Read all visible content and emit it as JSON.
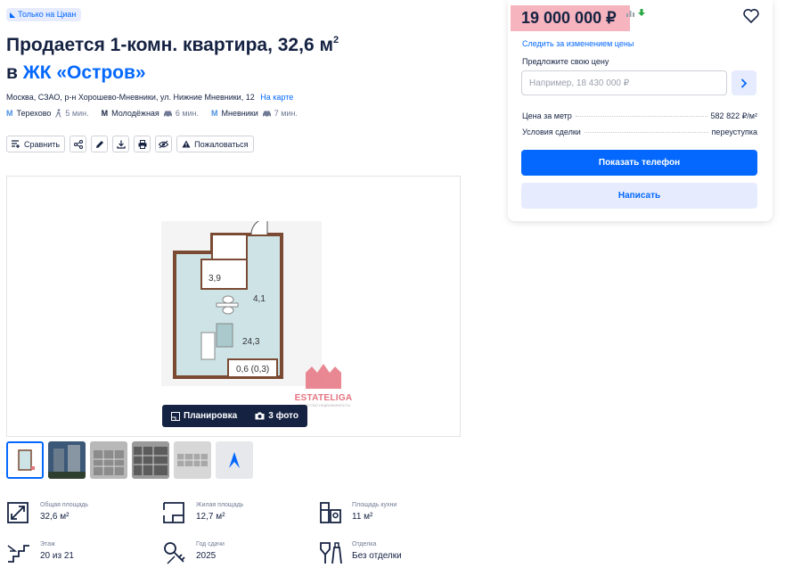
{
  "badge": {
    "label": "Только на Циан"
  },
  "title": {
    "line1": "Продается 1-комн. квартира, 32,6 м",
    "sup": "2",
    "prefix": "в ",
    "complex": "ЖК «Остров»"
  },
  "address": {
    "text": "Москва, СЗАО, р-н Хорошево-Мневники, ул. Нижние Мневники, 12",
    "map_link": "На карте"
  },
  "metro": [
    {
      "name": "Терехово",
      "time": "5 мин.",
      "mode": "walk-icon"
    },
    {
      "name": "Молодёжная",
      "time": "6 мин.",
      "mode": "car-icon"
    },
    {
      "name": "Мневники",
      "time": "7 мин.",
      "mode": "car-icon"
    }
  ],
  "actions": {
    "compare": "Сравнить",
    "complain": "Пожаловаться"
  },
  "gallery": {
    "tabs": {
      "plan": "Планировка",
      "photos": "3 фото"
    },
    "plan_labels": {
      "bath": "3,9",
      "hall": "4,1",
      "room": "24,3",
      "balcony": "0,6 (0,3)"
    },
    "watermark": {
      "brand": "ESTATELIGA",
      "sub": "АГЕНТСТВО НЕДВИЖИМОСТИ"
    }
  },
  "facts": [
    {
      "label": "Общая площадь",
      "value": "32,6 м²",
      "icon": "area-icon"
    },
    {
      "label": "Жилая площадь",
      "value": "12,7 м²",
      "icon": "living-area-icon"
    },
    {
      "label": "Площадь кухни",
      "value": "11 м²",
      "icon": "kitchen-icon"
    },
    {
      "label": "Этаж",
      "value": "20 из 21",
      "icon": "stairs-icon"
    },
    {
      "label": "Год сдачи",
      "value": "2025",
      "icon": "key-icon"
    },
    {
      "label": "Отделка",
      "value": "Без отделки",
      "icon": "paint-icon"
    }
  ],
  "side": {
    "price": "19 000 000 ₽",
    "follow": "Следить за изменением цены",
    "offer_label": "Предложите свою цену",
    "offer_placeholder": "Например, 18 430 000 ₽",
    "price_per_m_label": "Цена за метр",
    "price_per_m_value": "582 822 ₽/м²",
    "deal_label": "Условия сделки",
    "deal_value": "переуступка",
    "show_phone": "Показать телефон",
    "write": "Написать"
  },
  "colors": {
    "accent": "#0468ff",
    "text": "#152242",
    "price_highlight": "#f3a7b3"
  }
}
